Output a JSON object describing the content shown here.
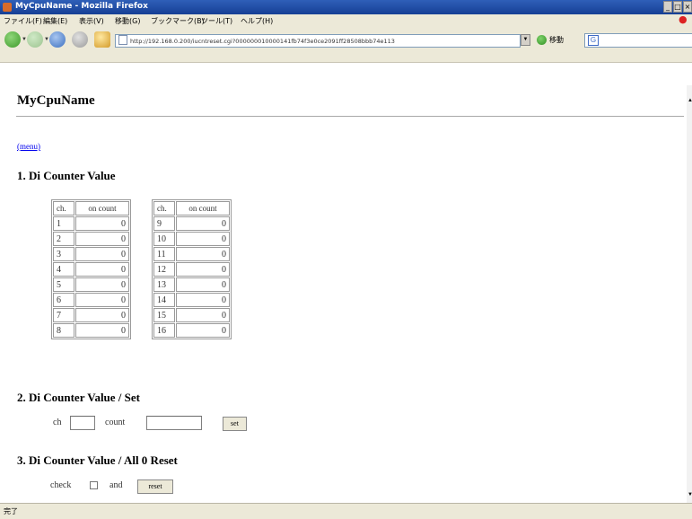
{
  "window": {
    "title": "MyCpuName - Mozilla Firefox",
    "buttons": [
      "_",
      "□",
      "×"
    ]
  },
  "menubar": [
    "ファイル(F)",
    "編集(E)",
    "表示(V)",
    "移動(G)",
    "ブックマーク(B)",
    "ツール(T)",
    "ヘルプ(H)"
  ],
  "navbar": {
    "url": "http://192.168.0.200/iucntreset.cgi?000000010000141fb74f3e0ce2091ff28508bbb74e113",
    "go_label": "移動",
    "search_letter": "G"
  },
  "page": {
    "title": "MyCpuName",
    "menu_link": "(menu)",
    "section1": "1. Di Counter Value",
    "table_header": {
      "ch": "ch.",
      "count": "on count"
    },
    "table_left": [
      {
        "ch": "1",
        "count": "0"
      },
      {
        "ch": "2",
        "count": "0"
      },
      {
        "ch": "3",
        "count": "0"
      },
      {
        "ch": "4",
        "count": "0"
      },
      {
        "ch": "5",
        "count": "0"
      },
      {
        "ch": "6",
        "count": "0"
      },
      {
        "ch": "7",
        "count": "0"
      },
      {
        "ch": "8",
        "count": "0"
      }
    ],
    "table_right": [
      {
        "ch": "9",
        "count": "0"
      },
      {
        "ch": "10",
        "count": "0"
      },
      {
        "ch": "11",
        "count": "0"
      },
      {
        "ch": "12",
        "count": "0"
      },
      {
        "ch": "13",
        "count": "0"
      },
      {
        "ch": "14",
        "count": "0"
      },
      {
        "ch": "15",
        "count": "0"
      },
      {
        "ch": "16",
        "count": "0"
      }
    ],
    "section2": "2. Di Counter Value /  Set",
    "set_form": {
      "ch_label": "ch",
      "ch_value": "",
      "count_label": "count",
      "count_value": "",
      "button": "set"
    },
    "section3": "3. Di Counter Value /  All 0 Reset",
    "reset_form": {
      "check_label": "check",
      "and_label": "and",
      "button": "reset"
    }
  },
  "status": {
    "text": "完了"
  }
}
